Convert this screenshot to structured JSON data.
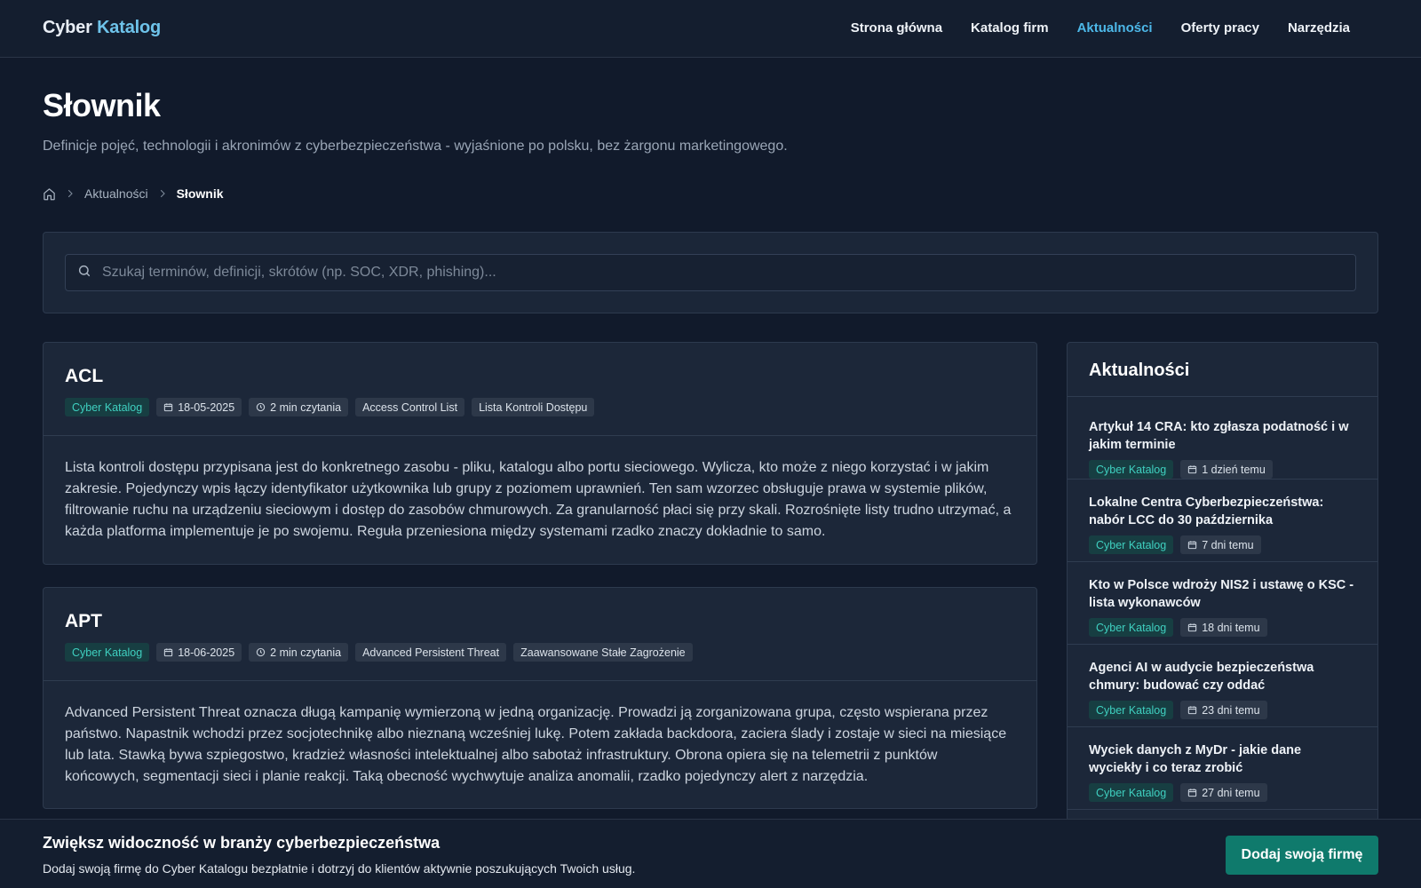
{
  "header": {
    "logo_part1": "Cyber",
    "logo_part2": "Katalog",
    "nav": [
      {
        "label": "Strona główna",
        "active": false
      },
      {
        "label": "Katalog firm",
        "active": false
      },
      {
        "label": "Aktualności",
        "active": true
      },
      {
        "label": "Oferty pracy",
        "active": false
      },
      {
        "label": "Narzędzia",
        "active": false
      }
    ]
  },
  "page": {
    "title": "Słownik",
    "subtitle": "Definicje pojęć, technologii i akronimów z cyberbezpieczeństwa - wyjaśnione po polsku, bez żargonu marketingowego."
  },
  "breadcrumb": {
    "home_icon": "home-icon",
    "items": [
      "Aktualności",
      "Słownik"
    ]
  },
  "search": {
    "placeholder": "Szukaj terminów, definicji, skrótów (np. SOC, XDR, phishing)..."
  },
  "terms": [
    {
      "term": "ACL",
      "source": "Cyber Katalog",
      "date": "18-05-2025",
      "read_time": "2 min czytania",
      "tags": [
        "Access Control List",
        "Lista Kontroli Dostępu"
      ],
      "definition": "Lista kontroli dostępu przypisana jest do konkretnego zasobu - pliku, katalogu albo portu sieciowego. Wylicza, kto może z niego korzystać i w jakim zakresie. Pojedynczy wpis łączy identyfikator użytkownika lub grupy z poziomem uprawnień. Ten sam wzorzec obsługuje prawa w systemie plików, filtrowanie ruchu na urządzeniu sieciowym i dostęp do zasobów chmurowych. Za granularność płaci się przy skali. Rozrośnięte listy trudno utrzymać, a każda platforma implementuje je po swojemu. Reguła przeniesiona między systemami rzadko znaczy dokładnie to samo."
    },
    {
      "term": "APT",
      "source": "Cyber Katalog",
      "date": "18-06-2025",
      "read_time": "2 min czytania",
      "tags": [
        "Advanced Persistent Threat",
        "Zaawansowane Stałe Zagrożenie"
      ],
      "definition": "Advanced Persistent Threat oznacza długą kampanię wymierzoną w jedną organizację. Prowadzi ją zorganizowana grupa, często wspierana przez państwo. Napastnik wchodzi przez socjotechnikę albo nieznaną wcześniej lukę. Potem zakłada backdoora, zaciera ślady i zostaje w sieci na miesiące lub lata. Stawką bywa szpiegostwo, kradzież własności intelektualnej albo sabotaż infrastruktury. Obrona opiera się na telemetrii z punktów końcowych, segmentacji sieci i planie reakcji. Taką obecność wychwytuje analiza anomalii, rzadko pojedynczy alert z narzędzia."
    }
  ],
  "sidebar": {
    "title": "Aktualności",
    "news": [
      {
        "title": "Artykuł 14 CRA: kto zgłasza podatność i w jakim terminie",
        "source": "Cyber Katalog",
        "ago": "1 dzień temu"
      },
      {
        "title": "Lokalne Centra Cyberbezpieczeństwa: nabór LCC do 30 października",
        "source": "Cyber Katalog",
        "ago": "7 dni temu"
      },
      {
        "title": "Kto w Polsce wdroży NIS2 i ustawę o KSC - lista wykonawców",
        "source": "Cyber Katalog",
        "ago": "18 dni temu"
      },
      {
        "title": "Agenci AI w audycie bezpieczeństwa chmury: budować czy oddać",
        "source": "Cyber Katalog",
        "ago": "23 dni temu"
      },
      {
        "title": "Wyciek danych z MyDr - jakie dane wyciekły i co teraz zrobić",
        "source": "Cyber Katalog",
        "ago": "27 dni temu"
      }
    ]
  },
  "banner": {
    "title": "Zwiększ widoczność w branży cyberbezpieczeństwa",
    "text": "Dodaj swoją firmę do Cyber Katalogu bezpłatnie i dotrzyj do klientów aktywnie poszukujących Twoich usług.",
    "cta_label": "Dodaj swoją firmę"
  },
  "colors": {
    "background": "#111a2b",
    "accent": "#4db8e8",
    "brand_tag": "#3fd0c0",
    "cta": "#0f7a6c"
  }
}
